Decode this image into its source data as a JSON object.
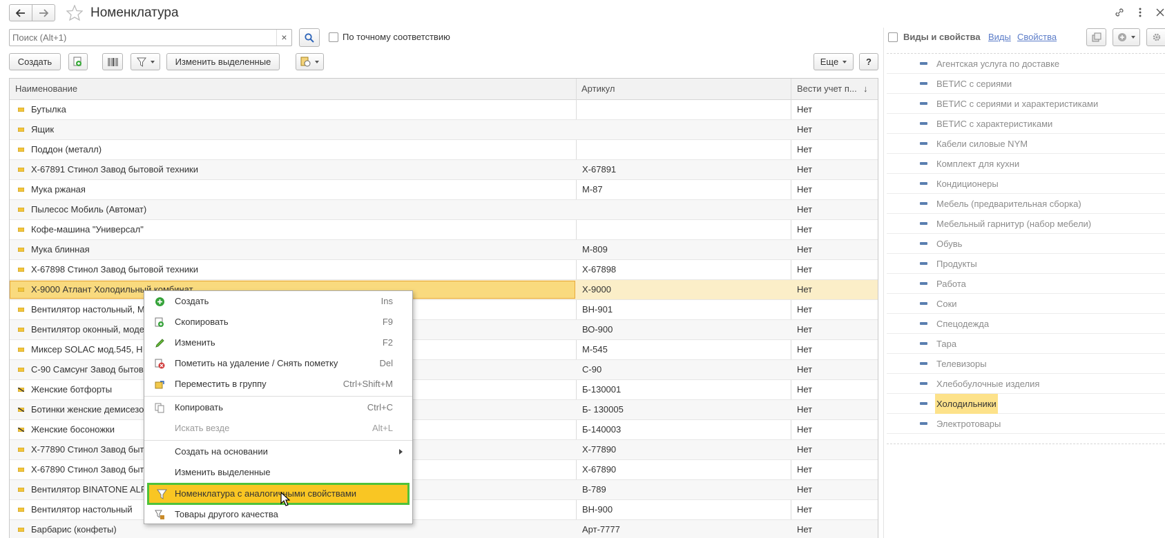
{
  "window": {
    "title": "Номенклатура"
  },
  "search": {
    "placeholder": "Поиск (Alt+1)",
    "clear": "×",
    "exact_match_label": "По точному соответствию"
  },
  "toolbar": {
    "create": "Создать",
    "change_selected": "Изменить выделенные",
    "more": "Еще",
    "help": "?"
  },
  "grid": {
    "columns": [
      "Наименование",
      "Артикул",
      "Вести учет п..."
    ],
    "sort_indicator": "↓",
    "rows": [
      {
        "name": "Бутылка",
        "art": "",
        "acc": "Нет"
      },
      {
        "name": "Ящик",
        "art": "",
        "acc": "Нет"
      },
      {
        "name": "Поддон (металл)",
        "art": "",
        "acc": "Нет"
      },
      {
        "name": "Х-67891 Стинол Завод бытовой техники",
        "art": "Х-67891",
        "acc": "Нет"
      },
      {
        "name": "Мука ржаная",
        "art": "М-87",
        "acc": "Нет"
      },
      {
        "name": "Пылесос Мобиль (Автомат)",
        "art": "",
        "acc": "Нет"
      },
      {
        "name": "Кофе-машина \"Универсал\"",
        "art": "",
        "acc": "Нет"
      },
      {
        "name": "Мука блинная",
        "art": "М-809",
        "acc": "Нет"
      },
      {
        "name": "Х-67898 Стинол Завод бытовой техники",
        "art": "Х-67898",
        "acc": "Нет"
      },
      {
        "name": "Х-9000 Атлант Холодильный комбинат",
        "art": "Х-9000",
        "acc": "Нет"
      },
      {
        "name": "Вентилятор настольный, М",
        "art": "ВН-901",
        "acc": "Нет"
      },
      {
        "name": "Вентилятор оконный, моде",
        "art": "ВО-900",
        "acc": "Нет"
      },
      {
        "name": "Миксер SOLAC мод.545, Н",
        "art": "М-545",
        "acc": "Нет"
      },
      {
        "name": "С-90 Самсунг Завод бытов",
        "art": "С-90",
        "acc": "Нет"
      },
      {
        "name": "Женские ботфорты",
        "art": "Б-130001",
        "acc": "Нет"
      },
      {
        "name": "Ботинки женские демисезо",
        "art": "Б- 130005",
        "acc": "Нет"
      },
      {
        "name": "Женские босоножки",
        "art": "Б-140003",
        "acc": "Нет"
      },
      {
        "name": "Х-77890 Стинол Завод быто",
        "art": "Х-77890",
        "acc": "Нет"
      },
      {
        "name": "Х-67890 Стинол Завод быто",
        "art": "Х-67890",
        "acc": "Нет"
      },
      {
        "name": "Вентилятор BINATONE ALF",
        "art": "В-789",
        "acc": "Нет"
      },
      {
        "name": "Вентилятор настольный",
        "art": "ВН-900",
        "acc": "Нет"
      },
      {
        "name": "Барбарис (конфеты)",
        "art": "Арт-7777",
        "acc": "Нет"
      }
    ]
  },
  "context_menu": {
    "items": [
      {
        "label": "Создать",
        "shortcut": "Ins",
        "icon": "create-plus-icon"
      },
      {
        "label": "Скопировать",
        "shortcut": "F9",
        "icon": "copy-item-icon"
      },
      {
        "label": "Изменить",
        "shortcut": "F2",
        "icon": "pencil-icon"
      },
      {
        "label": "Пометить на удаление / Снять пометку",
        "shortcut": "Del",
        "icon": "delete-mark-icon"
      },
      {
        "label": "Переместить в группу",
        "shortcut": "Ctrl+Shift+M",
        "icon": "move-to-group-icon"
      },
      {
        "label": "Копировать",
        "shortcut": "Ctrl+C",
        "icon": "clipboard-copy-icon"
      },
      {
        "label": "Искать везде",
        "shortcut": "Alt+L",
        "icon": ""
      },
      {
        "label": "Создать на основании",
        "shortcut": "",
        "icon": ""
      },
      {
        "label": "Изменить выделенные",
        "shortcut": "",
        "icon": ""
      },
      {
        "label": "Номенклатура с аналогичными свойствами",
        "shortcut": "",
        "icon": "filter-funnel-icon"
      },
      {
        "label": "Товары другого качества",
        "shortcut": "",
        "icon": "goods-quality-icon"
      }
    ]
  },
  "right_panel": {
    "title": "Виды и свойства",
    "link_kinds": "Виды",
    "link_props": "Свойства",
    "items": [
      "Агентская услуга по доставке",
      "ВЕТИС с сериями",
      "ВЕТИС с сериями и характеристиками",
      "ВЕТИС с характеристиками",
      "Кабели силовые NYM",
      "Комплект для кухни",
      "Кондиционеры",
      "Мебель (предварительная сборка)",
      "Мебельный гарнитур (набор мебели)",
      "Обувь",
      "Продукты",
      "Работа",
      "Соки",
      "Спецодежда",
      "Тара",
      "Телевизоры",
      "Хлебобулочные изделия",
      "Холодильники",
      "Электротовары"
    ],
    "selected": "Холодильники"
  },
  "colors": {
    "highlight": "#f9c623",
    "highlight_border": "#4fc23a",
    "row_selected": "#fbeec8",
    "selected_item_bg": "#fde28a"
  }
}
